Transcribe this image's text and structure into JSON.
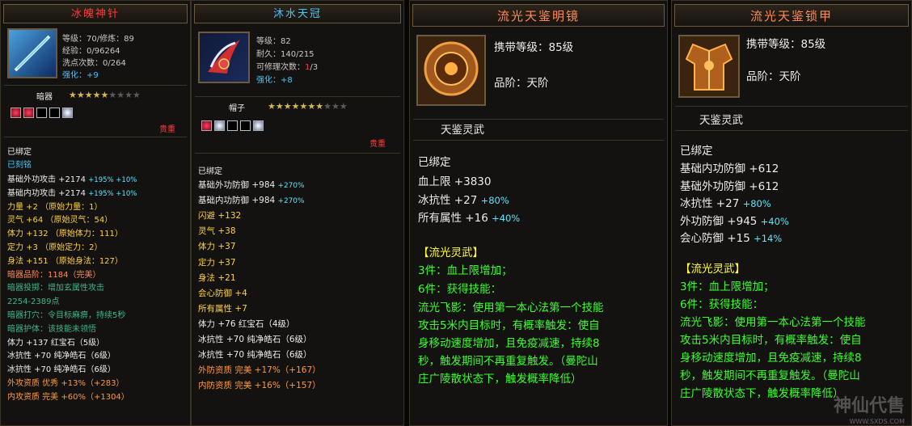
{
  "colors": {
    "accent_gold": "#d4b84a",
    "red": "#ff3a3a",
    "blue": "#46c6ff",
    "green": "#39ff2c",
    "yellow": "#ffff3a"
  },
  "p1": {
    "title": "冰魄神针",
    "level": "等级：70/修炼：89",
    "exp": "经验：0/96264",
    "wash": "洗点次数：0/264",
    "enhance_label": "强化：",
    "enhance_val": "+9",
    "type": "暗器",
    "stars_filled": 5,
    "stars_total": 9,
    "rarity": "贵重",
    "gems": [
      "red",
      "red",
      "empty",
      "empty",
      "white"
    ],
    "bound": "已绑定",
    "engraved": "已刻铭",
    "lines": [
      {
        "text": "基础外功攻击 +2174 ",
        "extra": "+195% +10%",
        "c": "c-white",
        "ec": "c-cyan"
      },
      {
        "text": "基础内功攻击 +2174 ",
        "extra": "+195% +10%",
        "c": "c-white",
        "ec": "c-cyan"
      },
      {
        "text": "力量 +2 （原始力量：1）",
        "extra": "",
        "c": "c-gold",
        "ec": ""
      },
      {
        "text": "灵气 +64 （原始灵气：54）",
        "extra": "",
        "c": "c-gold",
        "ec": ""
      },
      {
        "text": "体力 +132 （原始体力：111）",
        "extra": "",
        "c": "c-gold",
        "ec": ""
      },
      {
        "text": "定力 +3 （原始定力：2）",
        "extra": "",
        "c": "c-gold",
        "ec": ""
      },
      {
        "text": "身法 +151 （原始身法：127）",
        "extra": "",
        "c": "c-gold",
        "ec": ""
      },
      {
        "text": "暗器品阶：1184（完美）",
        "extra": "",
        "c": "c-salmon",
        "ec": ""
      },
      {
        "text": "暗器投掷：增加玄属性攻击",
        "extra": "",
        "c": "c-teal",
        "ec": ""
      },
      {
        "text": "2254-2389点",
        "extra": "",
        "c": "c-teal",
        "ec": ""
      },
      {
        "text": "暗器打穴：令目标麻痹，持续5秒",
        "extra": "",
        "c": "c-teal",
        "ec": ""
      },
      {
        "text": "暗器护体：该技能未领悟",
        "extra": "",
        "c": "c-teal",
        "ec": ""
      },
      {
        "text": "体力 +137 红宝石（5级）",
        "extra": "",
        "c": "c-white",
        "ec": ""
      },
      {
        "text": "冰抗性 +70 纯净皓石（6级）",
        "extra": "",
        "c": "c-white",
        "ec": ""
      },
      {
        "text": "冰抗性 +70 纯净皓石（6级）",
        "extra": "",
        "c": "c-white",
        "ec": ""
      },
      {
        "text": "外攻资质  优秀 +13%（+283）",
        "extra": "",
        "c": "c-orange",
        "ec": ""
      },
      {
        "text": "内攻资质  完美 +60%（+1304）",
        "extra": "",
        "c": "c-orange",
        "ec": ""
      }
    ]
  },
  "p2": {
    "title": "沐水天冠",
    "level": "等级：82",
    "durability": "耐久：140/215",
    "repair_label": "可修理次数：",
    "repair_cur": "1",
    "repair_max": "/3",
    "enhance_label": "强化：",
    "enhance_val": "+8",
    "type": "帽子",
    "stars_filled": 7,
    "stars_total": 10,
    "rarity": "贵重",
    "gems": [
      "red",
      "white",
      "empty",
      "empty",
      "white"
    ],
    "bound": "已绑定",
    "lines": [
      {
        "text": "基础外功防御 +984 ",
        "extra": "+270%",
        "c": "c-white",
        "ec": "c-cyan"
      },
      {
        "text": "基础内功防御 +984 ",
        "extra": "+270%",
        "c": "c-white",
        "ec": "c-cyan"
      },
      {
        "text": "闪避 +132",
        "extra": "",
        "c": "c-gold",
        "ec": ""
      },
      {
        "text": "灵气 +38",
        "extra": "",
        "c": "c-gold",
        "ec": ""
      },
      {
        "text": "体力 +37",
        "extra": "",
        "c": "c-gold",
        "ec": ""
      },
      {
        "text": "定力 +37",
        "extra": "",
        "c": "c-gold",
        "ec": ""
      },
      {
        "text": "身法 +21",
        "extra": "",
        "c": "c-gold",
        "ec": ""
      },
      {
        "text": "会心防御 +4",
        "extra": "",
        "c": "c-gold",
        "ec": ""
      },
      {
        "text": "所有属性 +7",
        "extra": "",
        "c": "c-gold",
        "ec": ""
      },
      {
        "text": "体力 +76 红宝石（4级）",
        "extra": "",
        "c": "c-white",
        "ec": ""
      },
      {
        "text": "冰抗性 +70 纯净皓石（6级）",
        "extra": "",
        "c": "c-white",
        "ec": ""
      },
      {
        "text": "冰抗性 +70 纯净皓石（6级）",
        "extra": "",
        "c": "c-white",
        "ec": ""
      },
      {
        "text": "外防资质  完美 +17%（+167）",
        "extra": "",
        "c": "c-orange",
        "ec": ""
      },
      {
        "text": "内防资质  完美 +16%（+157）",
        "extra": "",
        "c": "c-orange",
        "ec": ""
      }
    ]
  },
  "p3": {
    "title": "流光天鉴明镜",
    "carry": "携带等级：85级",
    "grade": "品阶：天阶",
    "sub": "天鉴灵武",
    "bound": "已绑定",
    "lines": [
      {
        "text": "血上限 +3830",
        "extra": "",
        "c": "c-white",
        "ec": ""
      },
      {
        "text": "冰抗性 +27 ",
        "extra": "+80%",
        "c": "c-white",
        "ec": "c-cyan"
      },
      {
        "text": "所有属性 +16 ",
        "extra": "+40%",
        "c": "c-white",
        "ec": "c-cyan"
      }
    ],
    "set_name": "【流光灵武】",
    "set3": "3件：血上限增加；",
    "set6": "6件：获得技能：",
    "skill": [
      "流光飞影：使用第一本心法第一个技能",
      "攻击5米内目标时，有概率触发：使自",
      "身移动速度增加，且免疫减速，持续8",
      "秒，触发期间不再重复触发。（曼陀山",
      "庄广陵散状态下，触发概率降低）"
    ]
  },
  "p4": {
    "title": "流光天鉴锁甲",
    "carry": "携带等级：85级",
    "grade": "品阶：天阶",
    "sub": "天鉴灵武",
    "bound": "已绑定",
    "lines": [
      {
        "text": "基础内功防御 +612",
        "extra": "",
        "c": "c-white",
        "ec": ""
      },
      {
        "text": "基础外功防御 +612",
        "extra": "",
        "c": "c-white",
        "ec": ""
      },
      {
        "text": "冰抗性 +27 ",
        "extra": "+80%",
        "c": "c-white",
        "ec": "c-cyan"
      },
      {
        "text": "外功防御 +945 ",
        "extra": "+40%",
        "c": "c-white",
        "ec": "c-cyan"
      },
      {
        "text": "会心防御 +15 ",
        "extra": "+14%",
        "c": "c-white",
        "ec": "c-cyan"
      }
    ],
    "set_name": "【流光灵武】",
    "set3": "3件：血上限增加；",
    "set6": "6件：获得技能：",
    "skill": [
      "流光飞影：使用第一本心法第一个技能",
      "攻击5米内目标时，有概率触发：使自",
      "身移动速度增加，且免疫减速，持续8",
      "秒，触发期间不再重复触发。（曼陀山",
      "庄广陵散状态下，触发概率降低）"
    ],
    "watermark": "神仙代售",
    "watermark_url": "WWW.SXDS.COM"
  }
}
